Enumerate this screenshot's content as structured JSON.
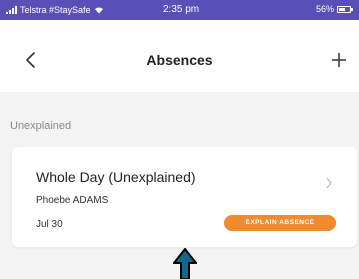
{
  "status_bar": {
    "carrier": "Telstra #StaySafe",
    "time": "2:35 pm",
    "battery": "56%",
    "battery_level": 0.56,
    "icons": [
      "signal-icon",
      "wifi-icon",
      "battery-icon"
    ]
  },
  "nav": {
    "title": "Absences",
    "icons": [
      "back-chevron-icon",
      "plus-icon"
    ]
  },
  "section": {
    "label": "Unexplained"
  },
  "absence": {
    "title": "Whole Day (Unexplained)",
    "student": "Phoebe ADAMS",
    "date": "Jul 30",
    "action_label": "EXPLAIN ABSENCE",
    "action_color": "#f08a2a"
  },
  "colors": {
    "status_bar": "#5a4fb7",
    "background": "#f3f3f3",
    "card": "#ffffff",
    "annotation_arrow": "#0d6b8a"
  }
}
